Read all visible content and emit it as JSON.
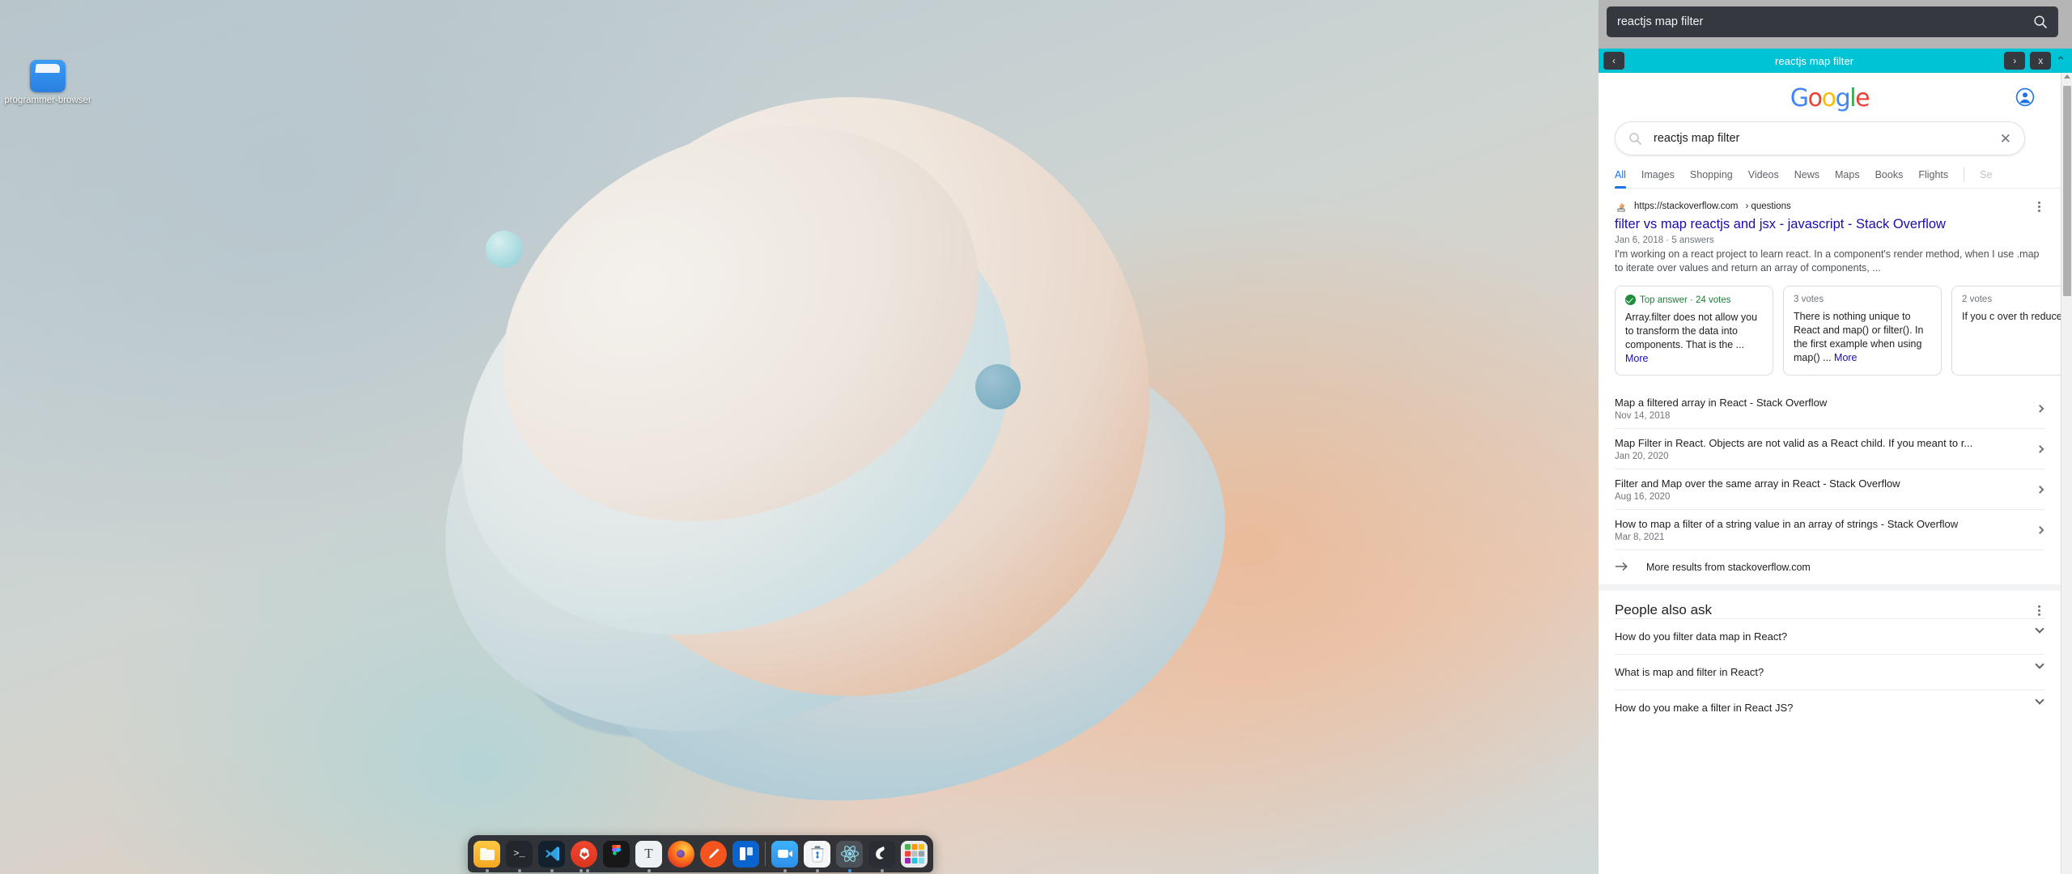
{
  "desktop": {
    "icon": {
      "label": "programmer-browser",
      "icon": "folder-icon"
    },
    "dock": {
      "items": [
        {
          "name": "files",
          "glyph": "📁",
          "bg": "#f7b733",
          "dots": 1
        },
        {
          "name": "terminal",
          "glyph": ">_",
          "bg": "#2b2f36",
          "dots": 1
        },
        {
          "name": "vscode",
          "glyph": "",
          "bg": "#1b2733",
          "dots": 1
        },
        {
          "name": "brave",
          "glyph": "",
          "bg": "#e03a24",
          "dots": 2
        },
        {
          "name": "figma",
          "glyph": "",
          "bg": "#1e1e1e",
          "dots": 0
        },
        {
          "name": "text-editor",
          "glyph": "T",
          "bg": "#eceff1",
          "dots": 1
        },
        {
          "name": "firefox",
          "glyph": "",
          "bg": "#f26b21",
          "dots": 0
        },
        {
          "name": "color-picker",
          "glyph": "",
          "bg": "#f4551f",
          "dots": 0
        },
        {
          "name": "trello",
          "glyph": "",
          "bg": "#0b63ce",
          "dots": 0
        },
        {
          "name": "video-call",
          "glyph": "",
          "bg": "#2ea7f5",
          "dots": 1
        },
        {
          "name": "trash",
          "glyph": "",
          "bg": "#f1f3f4",
          "dots": 1
        },
        {
          "name": "react-devtools",
          "glyph": "",
          "bg": "#4c5057",
          "dots": 1
        },
        {
          "name": "obs-studio",
          "glyph": "",
          "bg": "#2b2f36",
          "dots": 1
        },
        {
          "name": "app-grid",
          "glyph": "",
          "bg": "#e8eaed",
          "dots": 0
        }
      ]
    }
  },
  "panel": {
    "search": {
      "value": "reactjs map filter",
      "placeholder": "Search"
    },
    "nav": {
      "back_label": "‹",
      "title": "reactjs map filter",
      "forward_label": "›",
      "close_label": "x",
      "collapse_label": "⌃"
    }
  },
  "google": {
    "logo": {
      "g1": "G",
      "o1": "o",
      "o2": "o",
      "g2": "g",
      "l": "l",
      "e": "e"
    },
    "account_icon": "account-circle-icon",
    "searchbox": {
      "value": "reactjs map filter",
      "placeholder": "Search Google",
      "clear_label": "✕"
    },
    "tabs": [
      {
        "label": "All",
        "active": true
      },
      {
        "label": "Images",
        "active": false
      },
      {
        "label": "Shopping",
        "active": false
      },
      {
        "label": "Videos",
        "active": false
      },
      {
        "label": "News",
        "active": false
      },
      {
        "label": "Maps",
        "active": false
      },
      {
        "label": "Books",
        "active": false
      },
      {
        "label": "Flights",
        "active": false
      },
      {
        "label": "Se",
        "active": false,
        "dim": true
      }
    ],
    "result": {
      "domain": "https://stackoverflow.com",
      "breadcrumb": "› questions",
      "title": "filter vs map reactjs and jsx - javascript - Stack Overflow",
      "meta": "Jan 6, 2018 · 5 answers",
      "snippet": "I'm working on a react project to learn react. In a component's render method, when I use .map to iterate over values and return an array of components, ..."
    },
    "answer_cards": [
      {
        "badge": "Top answer · 24 votes",
        "is_top": true,
        "body": "Array.filter does not allow you to transform the data into components. That is the ...",
        "more": "More"
      },
      {
        "badge": "3 votes",
        "is_top": false,
        "body": "There is nothing unique to React and map() or filter(). In the first example when using map() ...",
        "more": "More"
      },
      {
        "badge": "2 votes",
        "is_top": false,
        "body": "If you c over th reduce .reduce",
        "more": ""
      }
    ],
    "sitelinks": [
      {
        "title": "Map a filtered array in React - Stack Overflow",
        "date": "Nov 14, 2018"
      },
      {
        "title": "Map Filter in React. Objects are not valid as a React child. If you meant to r...",
        "date": "Jan 20, 2020"
      },
      {
        "title": "Filter and Map over the same array in React - Stack Overflow",
        "date": "Aug 16, 2020"
      },
      {
        "title": "How to map a filter of a string value in an array of strings - Stack Overflow",
        "date": "Mar 8, 2021"
      }
    ],
    "more_results": {
      "label": "More results from stackoverflow.com",
      "icon": "arrow-right-icon"
    },
    "people_also_ask": {
      "title": "People also ask",
      "questions": [
        "How do you filter data map in React?",
        "What is map and filter in React?",
        "How do you make a filter in React JS?"
      ]
    }
  },
  "colors": {
    "panel_accent": "#00c4d6",
    "google_blue": "#1a73e8",
    "link_blue": "#1a0dab",
    "green": "#188038",
    "dark_chrome": "#35393f"
  }
}
